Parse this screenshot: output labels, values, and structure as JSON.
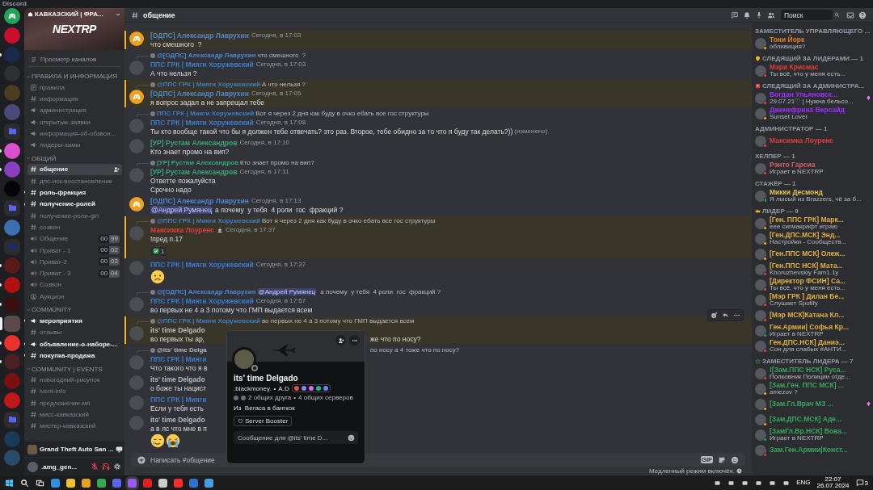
{
  "app_title": "Discord",
  "servers": [
    {
      "kind": "home",
      "color": "#23a55a",
      "unread": false,
      "selected": false
    },
    {
      "kind": "server",
      "color": "#c8102e",
      "unread": false,
      "selected": false
    },
    {
      "kind": "server",
      "color": "#1a2a4a",
      "unread": true,
      "selected": false
    },
    {
      "kind": "server",
      "color": "#2e3034",
      "unread": false,
      "selected": false
    },
    {
      "kind": "server",
      "color": "#4a3c20",
      "unread": false,
      "selected": false
    },
    {
      "kind": "server",
      "color": "#4a4a7a",
      "unread": false,
      "selected": false
    },
    {
      "kind": "folder",
      "color": "#5865f2",
      "unread": false,
      "selected": false
    },
    {
      "kind": "server",
      "color": "#d94fd0",
      "unread": true,
      "selected": false
    },
    {
      "kind": "server",
      "color": "#8a3fbf",
      "unread": true,
      "selected": false
    },
    {
      "kind": "server",
      "color": "#050505",
      "unread": false,
      "selected": false
    },
    {
      "kind": "folder",
      "color": "#5865f2",
      "unread": false,
      "selected": false
    },
    {
      "kind": "server",
      "color": "#3a6fb0",
      "unread": false,
      "selected": false
    },
    {
      "kind": "folder",
      "color": "#1e2a6a",
      "unread": false,
      "selected": false
    },
    {
      "kind": "server",
      "color": "#5a1a1a",
      "unread": true,
      "selected": false
    },
    {
      "kind": "server",
      "color": "#b01010",
      "unread": true,
      "selected": false
    },
    {
      "kind": "server",
      "color": "#3a1010",
      "unread": true,
      "selected": false
    },
    {
      "kind": "server",
      "color": "#5a4a4a",
      "unread": false,
      "selected": true
    },
    {
      "kind": "server",
      "color": "#e8322b",
      "unread": true,
      "selected": false
    },
    {
      "kind": "server",
      "color": "#4a2020",
      "unread": true,
      "selected": false
    },
    {
      "kind": "server",
      "color": "#7a1010",
      "unread": false,
      "selected": false
    },
    {
      "kind": "server",
      "color": "#c01818",
      "unread": false,
      "selected": false
    },
    {
      "kind": "folder",
      "color": "#5865f2",
      "unread": false,
      "selected": false
    },
    {
      "kind": "server",
      "color": "#1a3a5a",
      "unread": false,
      "selected": false
    },
    {
      "kind": "server",
      "color": "#2a4a6a",
      "unread": false,
      "selected": false
    }
  ],
  "server": {
    "name": "КАВКАЗСКИЙ | ФРА...",
    "banner_logo": "NEXTRP"
  },
  "browse_channels": "Просмотр каналов",
  "categories": [
    {
      "name": "ПРАВИЛА И ИНФОРМАЦИЯ",
      "channels": [
        {
          "name": "правила",
          "kind": "rules",
          "unread": false,
          "selected": false
        },
        {
          "name": "информация",
          "kind": "text",
          "unread": false,
          "selected": false
        },
        {
          "name": "администрация",
          "kind": "announce",
          "unread": false,
          "selected": false
        },
        {
          "name": "открытые-заявки",
          "kind": "announce",
          "unread": false,
          "selected": false
        },
        {
          "name": "информация-об-обзвон...",
          "kind": "announce",
          "unread": false,
          "selected": false
        },
        {
          "name": "лидеры-замы",
          "kind": "announce",
          "unread": false,
          "selected": false
        }
      ]
    },
    {
      "name": "ОБЩИЙ",
      "channels": [
        {
          "name": "общение",
          "kind": "text",
          "unread": false,
          "selected": true
        },
        {
          "name": "дпс-иск-восстановление",
          "kind": "text",
          "unread": false,
          "selected": false
        },
        {
          "name": "роль-фракция",
          "kind": "text",
          "unread": true,
          "selected": false
        },
        {
          "name": "получение-ролей",
          "kind": "text",
          "unread": true,
          "selected": false
        },
        {
          "name": "получение-роли-girl",
          "kind": "text",
          "unread": false,
          "selected": false
        },
        {
          "name": "созвон",
          "kind": "text",
          "unread": false,
          "selected": false
        },
        {
          "name": "Общение",
          "kind": "voice",
          "unread": false,
          "selected": false,
          "users": "00",
          "limit": "99"
        },
        {
          "name": "Приват - 1",
          "kind": "voice",
          "unread": false,
          "selected": false,
          "users": "00",
          "limit": "02"
        },
        {
          "name": "Приват-2",
          "kind": "voice",
          "unread": false,
          "selected": false,
          "users": "00",
          "limit": "03"
        },
        {
          "name": "Приват - 3",
          "kind": "voice",
          "unread": false,
          "selected": false,
          "users": "00",
          "limit": "04"
        },
        {
          "name": "Созвон",
          "kind": "voice",
          "unread": false,
          "selected": false
        },
        {
          "name": "Аукцион",
          "kind": "stage",
          "unread": false,
          "selected": false
        }
      ]
    },
    {
      "name": "COMMUNITY",
      "channels": [
        {
          "name": "мероприятия",
          "kind": "announce",
          "unread": true,
          "selected": false
        },
        {
          "name": "отзывы",
          "kind": "text",
          "unread": false,
          "selected": false
        },
        {
          "name": "объявление-о-наборе-...",
          "kind": "announce",
          "unread": true,
          "selected": false
        },
        {
          "name": "покупка-продажа",
          "kind": "text",
          "unread": true,
          "selected": false
        }
      ]
    },
    {
      "name": "COMMUNITY | EVENTS",
      "channels": [
        {
          "name": "новогодний-рисунок",
          "kind": "text",
          "unread": false,
          "selected": false
        },
        {
          "name": "ivent-info",
          "kind": "text",
          "unread": false,
          "selected": false
        },
        {
          "name": "предложение-мп",
          "kind": "text",
          "unread": false,
          "selected": false
        },
        {
          "name": "мисс-кавказский",
          "kind": "text",
          "unread": false,
          "selected": false
        },
        {
          "name": "мистер-кавказский",
          "kind": "text",
          "unread": false,
          "selected": false
        }
      ]
    }
  ],
  "activity": {
    "game": "Grand Theft Auto San ..."
  },
  "user": {
    "name": ".amg_gen...",
    "muted": true,
    "deafened": true
  },
  "channel_header": {
    "name": "общение",
    "search_placeholder": "Поиск"
  },
  "messages": [
    {
      "author": "[ОДПС] Александр Лаврухин",
      "color": "#4f86d0",
      "avatar": {
        "kind": "default"
      },
      "time": "Сегодня, в 17:03",
      "highlighted": true,
      "hovered": false,
      "lines": [
        {
          "text": "что смешного  ?"
        }
      ]
    },
    {
      "reply": {
        "author": "@[ОДПС] Александр Лаврухин",
        "color": "#4f86d0",
        "text": "что смешного  ?"
      },
      "author": "ППС ГРК | Мияги Хоружевский",
      "color": "#3d7cc9",
      "avatar": {
        "kind": "photo"
      },
      "time": "Сегодня, в 17:03",
      "highlighted": false,
      "hovered": false,
      "lines": [
        {
          "text": "А что нельзя ?"
        }
      ]
    },
    {
      "reply": {
        "author": "@ППС ГРК | Мияги Хоружевский",
        "color": "#3d7cc9",
        "text": "А что нельзя ?"
      },
      "author": "[ОДПС] Александр Лаврухин",
      "color": "#4f86d0",
      "avatar": {
        "kind": "default"
      },
      "time": "Сегодня, в 17:05",
      "highlighted": true,
      "hovered": false,
      "lines": [
        {
          "text": "я вопрос задал а не запрещал тебе"
        }
      ]
    },
    {
      "reply": {
        "author": "ППС ГРК | Мияги Хоружевский",
        "color": "#3d7cc9",
        "text": "Вот я через 2 дня как буду в очко ебать все гос структуры"
      },
      "author": "ППС ГРК | Мияги Хоружевский",
      "color": "#3d7cc9",
      "avatar": {
        "kind": "photo"
      },
      "time": "Сегодня, в 17:08",
      "highlighted": false,
      "hovered": false,
      "lines": [
        {
          "text": "Ты кто вообще такой что бы я должен тебе отвечать? это раз. Второе, тебе обидно за то что я буду так делать?))",
          "edited": "(изменено)"
        }
      ]
    },
    {
      "author": "[УР] Рустам Александров",
      "color": "#3aa676",
      "avatar": {
        "kind": "photo"
      },
      "time": "Сегодня, в 17:10",
      "highlighted": false,
      "hovered": false,
      "lines": [
        {
          "text": "Кто знает промо на вип?"
        }
      ]
    },
    {
      "reply": {
        "author": "[УР] Рустам Александров",
        "color": "#3aa676",
        "text": "Кто знает промо на вип?"
      },
      "author": "[УР] Рустам Александров",
      "color": "#3aa676",
      "avatar": {
        "kind": "photo"
      },
      "time": "Сегодня, в 17:11",
      "highlighted": false,
      "hovered": false,
      "lines": [
        {
          "text": "Ответте пожалуйста"
        },
        {
          "text": "Срочно надо"
        }
      ]
    },
    {
      "author": "[ОДПС] Александр Лаврухин",
      "color": "#4f86d0",
      "avatar": {
        "kind": "default"
      },
      "time": "Сегодня, в 17:13",
      "highlighted": false,
      "hovered": false,
      "lines": [
        {
          "mention": "@Андрей Румянец",
          "text": "а почему  у тебя  4 роли  гос  фракций ?"
        }
      ]
    },
    {
      "reply": {
        "author": "@ППС ГРК | Мияги Хоружевский",
        "color": "#3d7cc9",
        "text": "Вот я через 2 дня как буду в очко ебать все гос структуры"
      },
      "author": "Максимка Лоуренс",
      "color": "#e03c3c",
      "role_icon": true,
      "avatar": {
        "kind": "photo"
      },
      "time": "Сегодня, в 17:37",
      "highlighted": true,
      "hovered": false,
      "lines": [
        {
          "text": "!пред п.17"
        }
      ],
      "reaction": {
        "count": "1"
      }
    },
    {
      "author": "ППС ГРК | Мияги Хоружевский",
      "color": "#3d7cc9",
      "avatar": {
        "kind": "photo"
      },
      "time": "Сегодня, в 17:37",
      "highlighted": false,
      "hovered": false,
      "emojis": [
        {
          "kind": "frown"
        }
      ]
    },
    {
      "reply": {
        "author": "@[ОДПС] Александр Лаврухин",
        "color": "#4f86d0",
        "mention": "@Андрей Румянец",
        "text": "а почему  у тебя  4 роли  гос  фракций ?"
      },
      "author": "ППС ГРК | Мияги Хоружевский",
      "color": "#3d7cc9",
      "avatar": {
        "kind": "photo"
      },
      "time": "Сегодня, в 17:57",
      "highlighted": false,
      "hovered": false,
      "lines": [
        {
          "text": "во первых не 4 а 3 потому что ГМП выдается всем"
        }
      ]
    },
    {
      "reply": {
        "author": "@ППС ГРК | Мияги Хоружевский",
        "color": "#3d7cc9",
        "text": "во первых не 4 а 3 потому что ГМП выдается всем"
      },
      "author": "its' time Delgado",
      "color": "#b5bac1",
      "avatar": {
        "kind": "photo"
      },
      "highlighted": true,
      "hovered": true,
      "lines": [
        {
          "text": "во первых ты ар,",
          "text_right": "же что по носу?"
        }
      ]
    },
    {
      "reply": {
        "author": "@its' time Delga",
        "color": "#b5bac1",
        "text_right": "по носу а 4 тоже что по носу?"
      },
      "author": "ППС ГРК | Мияги",
      "color": "#3d7cc9",
      "avatar": {
        "kind": "photo"
      },
      "highlighted": false,
      "hovered": false,
      "lines": [
        {
          "text": "Что такого что я в"
        }
      ]
    },
    {
      "author": "its' time Delgado",
      "color": "#b5bac1",
      "avatar": {
        "kind": "photo"
      },
      "highlighted": false,
      "hovered": false,
      "lines": [
        {
          "text": "о боже ты нацист"
        }
      ]
    },
    {
      "author": "ППС ГРК | Мияги",
      "color": "#3d7cc9",
      "avatar": {
        "kind": "photo"
      },
      "highlighted": false,
      "hovered": false,
      "lines": [
        {
          "text": "Если у тебя есть"
        }
      ]
    },
    {
      "author": "its' time Delgado",
      "color": "#b5bac1",
      "avatar": {
        "kind": "photo"
      },
      "highlighted": false,
      "hovered": false,
      "lines": [
        {
          "text": "а в лс что мне в п"
        }
      ],
      "emojis": [
        {
          "kind": "tear-smile"
        },
        {
          "kind": "crying"
        }
      ]
    }
  ],
  "composer": {
    "placeholder": "Написать #общение",
    "gif_label": "GIF",
    "slowmode": "Медленный режим включён."
  },
  "profile_popup": {
    "display_name": "its' time Delgado",
    "username": ".blackmoney.",
    "username_separator": "•",
    "tag": "A.D",
    "badges": [
      {
        "color": "#e0504a"
      },
      {
        "color": "#7f8cff"
      },
      {
        "color": "#d070f0"
      },
      {
        "color": "#20b090"
      },
      {
        "color": "#6a80ff"
      }
    ],
    "mutual_friends": "2 общих друга",
    "mutual_separator": "•",
    "mutual_servers": "4 общих серверов",
    "bio": "Из  Вегаса в бангкок",
    "role": "Server Booster",
    "message_placeholder": "Сообщение для @its' time D..."
  },
  "member_groups": [
    {
      "title": "ЗАМЕСТИТЕЛЬ УПРАВЛЯЮЩЕГО ...",
      "kind": "plain",
      "members": [
        {
          "name": "Тони Йорк",
          "color": "#e67e22",
          "activity": "обливиция?",
          "status": {
            "kind": "idle"
          },
          "booster": false
        }
      ]
    },
    {
      "title": "СЛЕДЯЩИЙ ЗА ЛИДЕРАМИ — 1",
      "kind": "shield",
      "members": [
        {
          "name": "Мэри Крисмас",
          "color": "#e03c3c",
          "activity": "Ты всё, что у меня есть...",
          "status": {
            "kind": "dnd"
          },
          "booster": false
        }
      ]
    },
    {
      "title": "СЛЕДЯЩИЙ ЗА АДМИНИСТРА...",
      "kind": "badge",
      "members": [
        {
          "name": "Богдан Ульяновск...",
          "color": "#9b30ff",
          "activity": "29.07.21♡ | Нужна бельсо...",
          "status": {
            "kind": "dnd"
          },
          "booster": true
        },
        {
          "name": "Дженефрина Версайд",
          "color": "#9b30ff",
          "activity": "Sunset Lover",
          "status": {
            "kind": "idle"
          },
          "booster": false
        }
      ]
    },
    {
      "title": "АДМИНИСТРАТОР — 1",
      "kind": "plain",
      "members": [
        {
          "name": "Максимка Лоуренс",
          "color": "#e03c3c",
          "status": {
            "kind": "dnd"
          },
          "booster": false
        }
      ]
    },
    {
      "title": "ХЕЛПЕР — 1",
      "kind": "plain",
      "members": [
        {
          "name": "Рэнто Гарсиа",
          "color": "#d9606b",
          "activity": "Играет в NEXTRP",
          "status": {
            "kind": "dnd"
          },
          "booster": false
        }
      ]
    },
    {
      "title": "СТАЖЁР — 1",
      "kind": "plain",
      "members": [
        {
          "name": "Микки Десмонд",
          "color": "#e3c35a",
          "activity": "Я лысый из Brazzers, чё за б...",
          "status": {
            "kind": "mobile"
          },
          "booster": false
        }
      ]
    },
    {
      "title": "ЛИДЕР — 9",
      "kind": "crown",
      "members": [
        {
          "name": "[Ген. ППС ГРК] Марк...",
          "color": "#e0b040",
          "activity": "еее сигмакрафт играю",
          "status": {
            "kind": "idle"
          },
          "booster": false
        },
        {
          "name": "[Ген.ДПС.МСК] Энд...",
          "color": "#e0b040",
          "activity": "Настройки - Сообществ...",
          "status": {
            "kind": "idle"
          },
          "booster": false
        },
        {
          "name": "[Ген.ППС МСК] Олеж...",
          "color": "#e0b040",
          "status": {
            "kind": "idle"
          },
          "booster": false
        },
        {
          "name": "[Ген.ППС НСК] Мата...",
          "color": "#e0b040",
          "activity": "Khoruzhevskiy Fam1.1y",
          "status": {
            "kind": "dnd"
          },
          "booster": false
        },
        {
          "name": "[Директор ФСИН] Са...",
          "color": "#e0b040",
          "activity": "Ты всё, что у меня есть...",
          "status": {
            "kind": "dnd"
          },
          "booster": false
        },
        {
          "name": "[Мэр ГРК ] Дилан Бе...",
          "color": "#e0b040",
          "activity": "Слушает Spotify",
          "status": {
            "kind": "dnd"
          },
          "booster": false
        },
        {
          "name": "[Мэр МСК]Катана Кл...",
          "color": "#e0b040",
          "status": {
            "kind": "dnd"
          },
          "booster": false
        },
        {
          "name": "Ген.Армии| Софья Кр...",
          "color": "#e0b040",
          "activity": "Играет в NEXTRP",
          "status": {
            "kind": "online"
          },
          "booster": false
        },
        {
          "name": "Ген.ДПС.НСК] Даниэ...",
          "color": "#e0b040",
          "activity": "Сон для слабых #АНТИ...",
          "status": {
            "kind": "dnd"
          },
          "booster": false
        }
      ]
    },
    {
      "title": "ЗАМЕСТИТЕЛЬ ЛИДЕРА — 7",
      "kind": "star",
      "members": [
        {
          "name": "![Зам.ППС НСК] Руса...",
          "color": "#3ba55d",
          "activity": "Полковник Полиции отде...",
          "status": {
            "kind": "dnd"
          },
          "booster": false
        },
        {
          "name": "[Зам.Ген. ППС МСК] ...",
          "color": "#3ba55d",
          "activity": "amezov ?",
          "status": {
            "kind": "idle"
          },
          "booster": false
        },
        {
          "name": "[Зам.Гл.Врач МЗ ...",
          "color": "#3ba55d",
          "status": {
            "kind": "idle"
          },
          "booster": true
        },
        {
          "name": "[Зам.ДПС.МСК] Аде...",
          "color": "#3ba55d",
          "status": {
            "kind": "idle"
          },
          "booster": false
        },
        {
          "name": "[ЗамГл.Вр.НСК] Вова...",
          "color": "#3ba55d",
          "activity": "Играет в NEXTRP",
          "status": {
            "kind": "online"
          },
          "booster": false
        },
        {
          "name": "Зам.Ген.Армии|Конст...",
          "color": "#3ba55d",
          "status": {
            "kind": "dnd"
          },
          "booster": false
        }
      ]
    }
  ],
  "taskbar": {
    "apps": [
      {
        "active": false
      },
      {
        "active": false
      },
      {
        "active": false
      },
      {
        "active": false
      },
      {
        "active": false
      },
      {
        "active": true
      },
      {
        "active": false
      },
      {
        "active": false
      },
      {
        "active": false
      },
      {
        "active": false
      },
      {
        "active": false
      }
    ],
    "language": "ENG",
    "time": "22:07",
    "date": "26.07.2024",
    "notifications": "3"
  }
}
